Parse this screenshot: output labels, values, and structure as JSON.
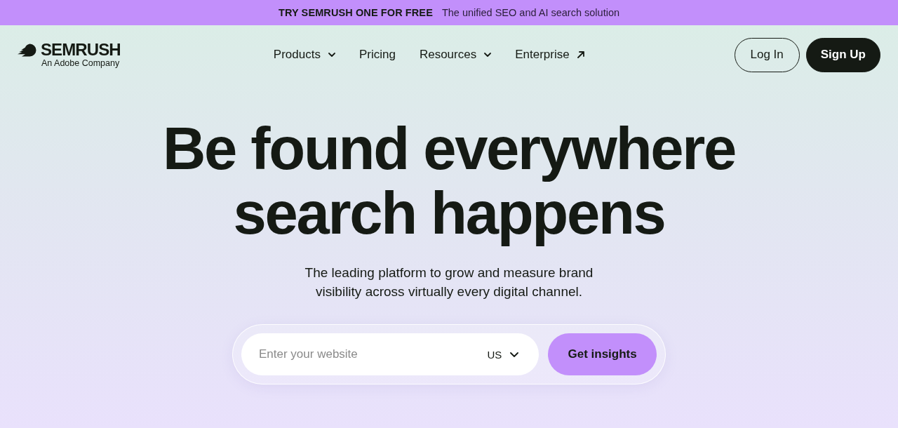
{
  "promo_banner": {
    "title": "TRY SEMRUSH ONE FOR FREE",
    "text": "The unified SEO and AI search solution"
  },
  "header": {
    "logo": {
      "name": "SEMRUSH",
      "tagline": "An Adobe Company"
    },
    "nav": [
      {
        "label": "Products",
        "kind": "dropdown"
      },
      {
        "label": "Pricing",
        "kind": "link"
      },
      {
        "label": "Resources",
        "kind": "dropdown"
      },
      {
        "label": "Enterprise",
        "kind": "external"
      }
    ],
    "buttons": [
      {
        "label": "Log In",
        "kind": "outline"
      },
      {
        "label": "Sign Up",
        "kind": "primary"
      }
    ]
  },
  "hero": {
    "headline": [
      "Be found everywhere",
      "search happens"
    ],
    "subtitle": [
      "The leading platform to grow and measure brand",
      "visibility across virtually every digital channel."
    ],
    "search": {
      "placeholder": "Enter your website",
      "country": "US",
      "button": "Get insights"
    }
  }
}
